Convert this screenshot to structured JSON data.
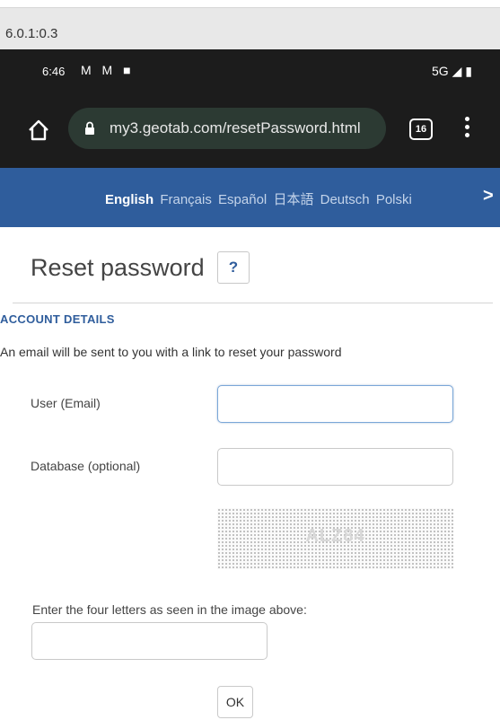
{
  "debug": {
    "version": "6.0.1:0.3"
  },
  "status_bar": {
    "time": "6:46",
    "notification_icons": "M M ■",
    "network": "5G ◢ ▮"
  },
  "browser": {
    "url": "my3.geotab.com/resetPassword.html",
    "tab_count": "16"
  },
  "languages": {
    "active": "English",
    "items": [
      "Français",
      "Español",
      "日本語",
      "Deutsch",
      "Polski"
    ],
    "next_arrow": ">"
  },
  "page": {
    "title": "Reset password",
    "help_label": "?",
    "section_heading": "ACCOUNT DETAILS",
    "instruction": "An email will be sent to you with a link to reset your password"
  },
  "form": {
    "user_label": "User (Email)",
    "user_value": "",
    "database_label": "Database (optional)",
    "database_value": "",
    "captcha_text": "ALZ84",
    "captcha_label": "Enter the four letters as seen in the image above:",
    "captcha_value": "",
    "submit_label": "OK"
  },
  "colors": {
    "brand_blue": "#2f5d9c",
    "browser_dark": "#1c1c1c",
    "url_pill": "#2c3a33"
  },
  "icons": {
    "home": "home-icon",
    "lock": "lock-icon",
    "menu": "more-vert-icon",
    "tabs": "tabs-count-icon"
  }
}
